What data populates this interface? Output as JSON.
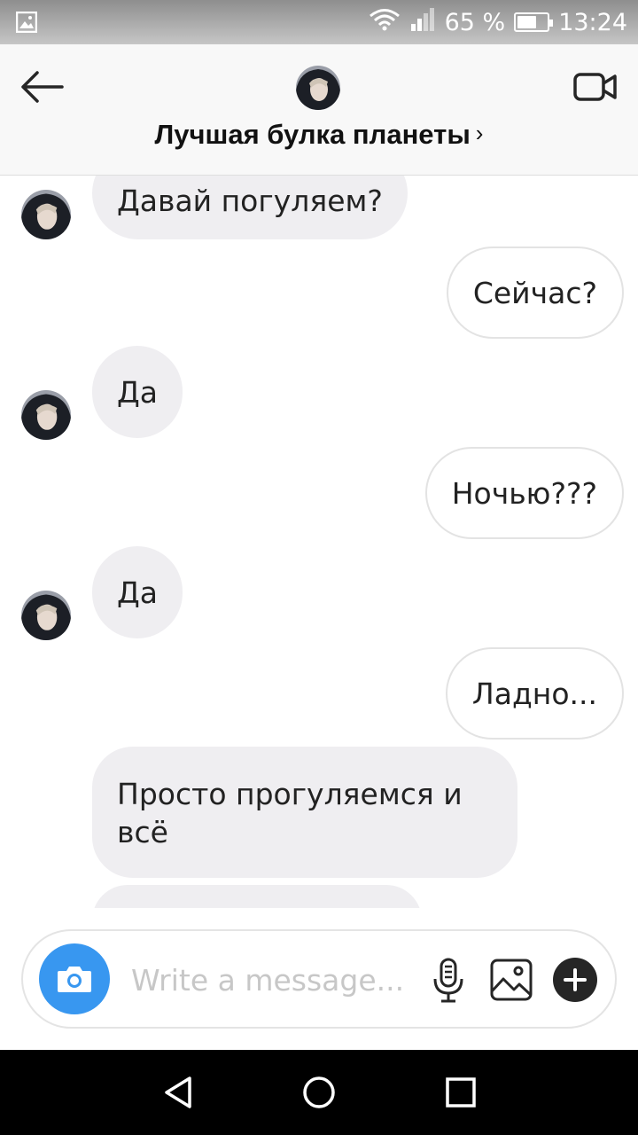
{
  "status_bar": {
    "battery_percent": "65 %",
    "battery_level": 0.65,
    "time": "13:24"
  },
  "header": {
    "title": "Лучшая булка планеты",
    "chevron": "›"
  },
  "messages": [
    {
      "side": "in",
      "text": "Давай погуляем?"
    },
    {
      "side": "out",
      "text": "Сейчас?"
    },
    {
      "side": "in",
      "text": "Да"
    },
    {
      "side": "out",
      "text": "Ночью???"
    },
    {
      "side": "in",
      "text": "Да"
    },
    {
      "side": "out",
      "text": "Ладно..."
    },
    {
      "side": "in",
      "text": "Просто прогуляемся и всё"
    }
  ],
  "composer": {
    "placeholder": "Write a message..."
  },
  "colors": {
    "accent": "#3897f0",
    "incoming_bubble": "#efeef1",
    "outgoing_border": "#e3e3e3"
  },
  "icons": [
    "gallery-status-icon",
    "wifi-icon",
    "signal-icon",
    "battery-icon",
    "back-arrow-icon",
    "video-call-icon",
    "camera-icon",
    "microphone-icon",
    "image-icon",
    "plus-icon",
    "nav-back-icon",
    "nav-home-icon",
    "nav-recents-icon"
  ]
}
